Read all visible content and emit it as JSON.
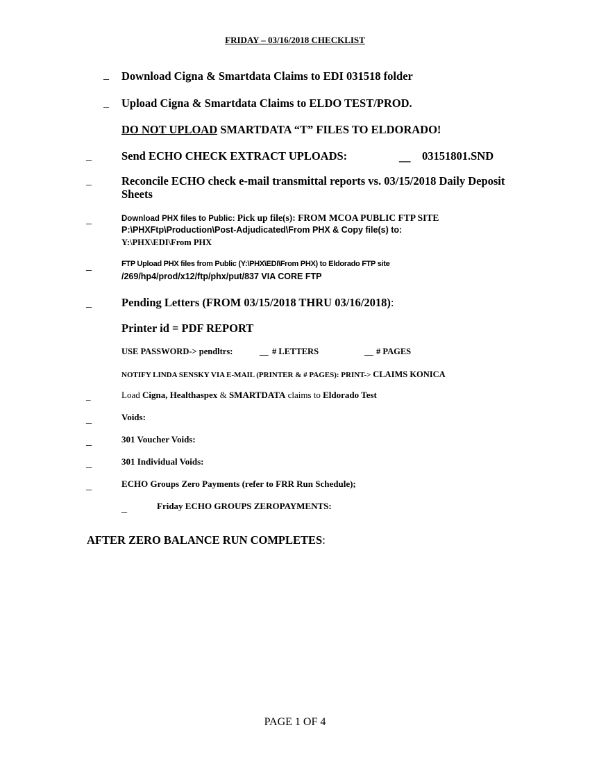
{
  "title": "FRIDAY – 03/16/2018 CHECKLIST",
  "marks": {
    "blank": "_",
    "double_blank": "__"
  },
  "items": {
    "download_cigna": "Download Cigna & Smartdata Claims to EDI 031518 folder",
    "upload_cigna": "Upload Cigna & Smartdata Claims to ELDO TEST/PROD.",
    "do_not_upload_u": "DO NOT UPLOAD",
    "do_not_upload_rest": " SMARTDATA “T” FILES TO ELDORADO!",
    "send_echo": "Send ECHO CHECK EXTRACT UPLOADS:",
    "send_echo_file": "03151801.SND",
    "reconcile_line1": "Reconcile ECHO check e-mail transmittal reports vs. 03/15/2018 Daily Deposit",
    "reconcile_line2": "Sheets",
    "phx_download_a": "Download PHX files to Public:  ",
    "phx_download_b": "Pick up file(s): FROM MCOA PUBLIC FTP SITE",
    "phx_download_line2": "P:\\PHXFtp\\Production\\Post-Adjudicated\\From PHX & Copy file(s) to:",
    "phx_download_line3": "Y:\\PHX\\EDI\\From PHX",
    "ftp_upload_line1": "FTP Upload PHX files from Public (Y:\\PHX\\EDI\\From PHX) to Eldorado FTP site",
    "ftp_upload_line2": "/269/hp4/prod/x12/ftp/phx/put/837 VIA CORE FTP",
    "pending_letters": "Pending Letters (FROM 03/15/2018 THRU 03/16/2018)",
    "pending_colon": ":",
    "printer_id": "Printer id = PDF REPORT",
    "use_password": "USE PASSWORD-> pendltrs:",
    "letters": "# LETTERS",
    "pages": "# PAGES",
    "notify": "NOTIFY LINDA SENSKY VIA E-MAIL (PRINTER & # PAGES): PRINT-> ",
    "notify_claims": "CLAIMS KONICA",
    "load_a": "Load ",
    "load_b": "Cigna, Healthaspex",
    "load_c": " & ",
    "load_d": "SMARTDATA",
    "load_e": " claims to ",
    "load_f": "Eldorado Test",
    "voids": "Voids:",
    "voucher_voids": "301 Voucher Voids:",
    "individual_voids": "301 Individual Voids:",
    "echo_zero": "ECHO Groups Zero Payments (refer to FRR Run Schedule);",
    "friday_echo": "Friday ECHO GROUPS ZEROPAYMENTS:"
  },
  "after_zero": "AFTER ZERO BALANCE RUN COMPLETES",
  "after_zero_colon": ":",
  "footer": "PAGE 1 OF 4"
}
